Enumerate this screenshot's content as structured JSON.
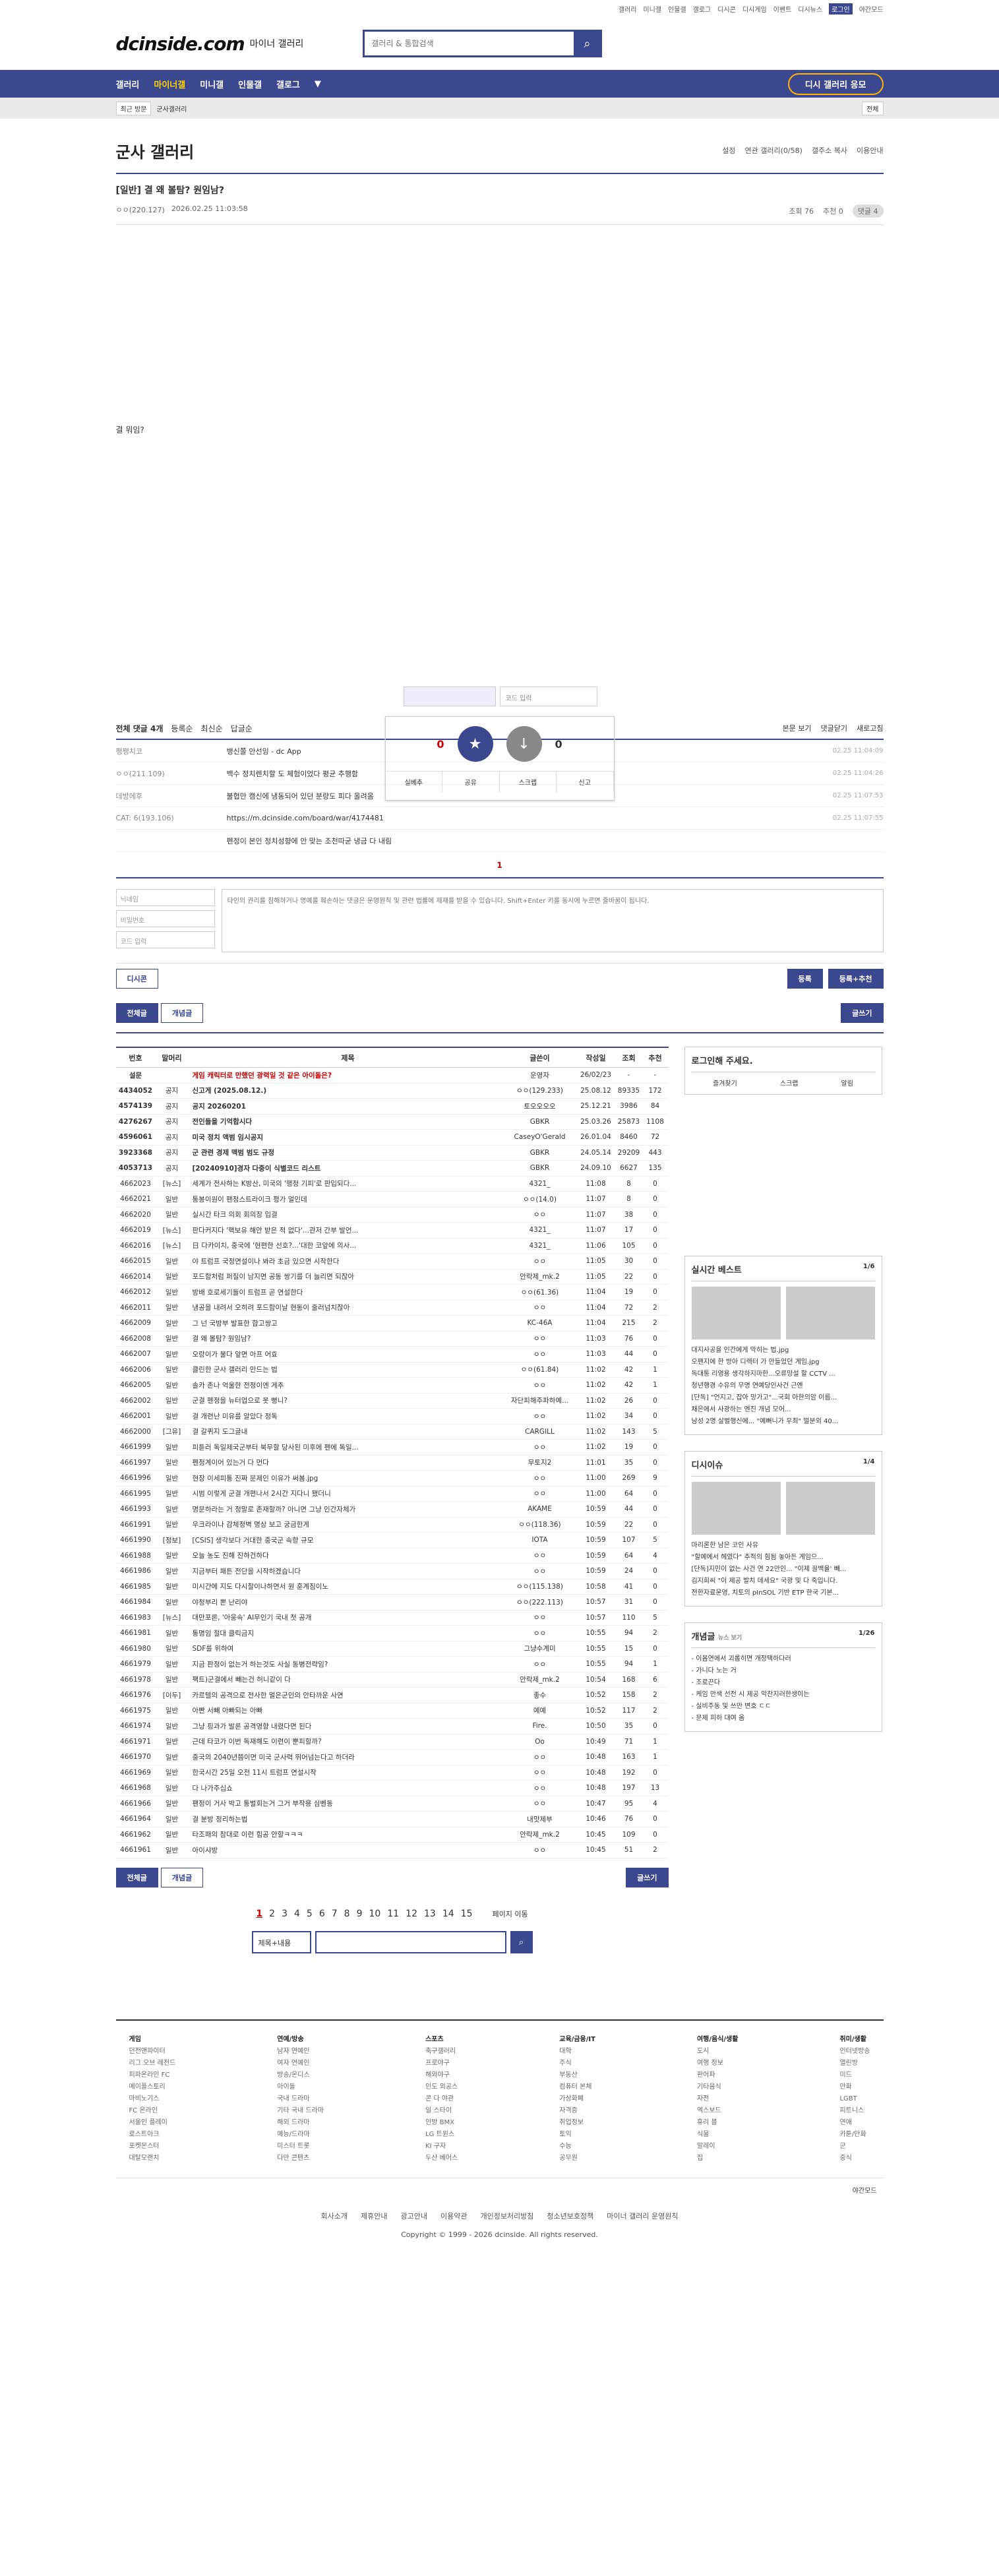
{
  "top": {
    "links": [
      "갤러리",
      "미니갤",
      "인물갤",
      "갤로그",
      "디시콘",
      "디시게임",
      "이벤트",
      "디시뉴스"
    ],
    "mylog": "로그인",
    "dark": "야간모드"
  },
  "brand": {
    "logo": "dcinside.com",
    "sub": "마이너 갤러리",
    "search_placeholder": "갤러리 & 통합검색"
  },
  "gnb": {
    "items": [
      "갤러리",
      "마이너갤",
      "미니갤",
      "인물갤",
      "갤로그"
    ],
    "right": "디시 갤러리 응모"
  },
  "subnav": {
    "recent": "최근 방문",
    "item": "군사갤러리",
    "all": "전체"
  },
  "gallery": {
    "title": "군사 갤러리",
    "opts": [
      "설정",
      "연관 갤러리(0/58)",
      "갤주소 복사",
      "이용안내"
    ]
  },
  "post": {
    "title": "[일반] 결 왜 볼탐? 원임남?",
    "author": "ㅇㅇ(220.127)",
    "date": "2026.02.25 11:03:58",
    "views": "조회 76",
    "rec": "추천 0",
    "cmt": "댓글 4",
    "body": "결 뭐임?"
  },
  "vote": {
    "up": "0",
    "down": "0",
    "up_label": "개념",
    "down_label": "비추",
    "actions": [
      "실베추",
      "공유",
      "스크랩",
      "신고"
    ],
    "captcha": "코드 입력"
  },
  "comments": {
    "head": "전체 댓글 4개",
    "sort": [
      "등록순",
      "최신순",
      "답글순"
    ],
    "right": [
      "본문 보기",
      "댓글닫기",
      "새로고침"
    ],
    "list": [
      {
        "n": "팽팽치코",
        "c": "뱅신쫄 안선잉 - dc App",
        "d": "02.25 11:04:09"
      },
      {
        "n": "ㅇㅇ(211.109)",
        "c": "백수 정치렌치할 도 체험이었다 평균 추행함",
        "d": "02.25 11:04:26"
      },
      {
        "n": "데방에후",
        "c": "불협만 캠신에 냉동되어 있던 분량도 피다 올려옴",
        "d": "02.25 11:07:53"
      },
      {
        "n": "CAT: 6(193.106)",
        "c": "https://m.dcinside.com/board/war/4174481",
        "d": "02.25 11:07:55"
      },
      {
        "n": "",
        "c": "펜정이 본인 정치성향에 안 맞는 조천따굳 냉금 다 내림",
        "d": ""
      }
    ],
    "page": "1"
  },
  "write": {
    "name": "닉네임",
    "pw": "비밀번호",
    "code": "코드 입력",
    "textarea": "타인의 권리를 침해하거나 명예를 훼손하는 댓글은 운영원칙 및 관련 법률에 제재를 받을 수 있습니다. Shift+Enter 키를 동시에 누르면 줄바꿈이 됩니다.",
    "dc": "디시콘",
    "submit": "등록",
    "submit2": "등록+추천"
  },
  "tabs": {
    "all": "전체글",
    "good": "개념글",
    "write": "글쓰기"
  },
  "list": {
    "headers": [
      "번호",
      "말머리",
      "제목",
      "글쓴이",
      "작성일",
      "조회",
      "추천"
    ],
    "rows": [
      [
        "설문",
        "",
        "게임 캐릭터로 만했던 광력일 것 같은 아이돌은?",
        "운영자",
        "26/02/23",
        "-",
        "-",
        "nr"
      ],
      [
        "4434052",
        "공지",
        "신고게 (2025.08.12.)",
        "ㅇㅇ(129.233)",
        "25.08.12",
        "89335",
        "172",
        "n"
      ],
      [
        "4574139",
        "공지",
        "공지 20260201",
        "토오오오오",
        "25.12.21",
        "3986",
        "84",
        "n"
      ],
      [
        "4276267",
        "공지",
        "전인들을 기억합시다",
        "GBKR",
        "25.03.26",
        "25873",
        "1108",
        "n"
      ],
      [
        "4596061",
        "공지",
        "미국 정치 액범 임시공지",
        "CaseyO'Gerald",
        "26.01.04",
        "8460",
        "72",
        "n"
      ],
      [
        "3923368",
        "공지",
        "군 관련 경제 맥범 범도 규정",
        "GBKR",
        "24.05.14",
        "29209",
        "443",
        "n"
      ],
      [
        "4053713",
        "공지",
        "[20240910]경자 다중이 식별코드 리스트",
        "GBKR",
        "24.09.10",
        "6627",
        "135",
        "n"
      ],
      [
        "4662023",
        "[뉴스]",
        "세계가 전사하는 K방산, 미국의 '행정 기피'로 판입되다...",
        "4321_",
        "11:08",
        "8",
        "0",
        ""
      ],
      [
        "4662021",
        "일반",
        "통봉이원이 팬정스트라이크 평가 얼인데",
        "ㅇㅇ(14.0)",
        "11:07",
        "8",
        "0",
        ""
      ],
      [
        "4662020",
        "일반",
        "실시간 타크 의회 회의장 입결",
        "ㅇㅇ",
        "11:07",
        "38",
        "0",
        ""
      ],
      [
        "4662019",
        "[뉴스]",
        "판다커지다 '핵보유 해안 받은 적 없다'...관저 간부 발언...",
        "4321_",
        "11:07",
        "17",
        "0",
        ""
      ],
      [
        "4662016",
        "[뉴스]",
        "日 다카이치, 중국에 '현편한 선호?...'대한 코앞에 의사...",
        "4321_",
        "11:06",
        "105",
        "0",
        ""
      ],
      [
        "4662015",
        "일반",
        "야 트럼프 국정연설이나 봐라 초금 있으면 시작한다",
        "ㅇㅇ",
        "11:05",
        "30",
        "0",
        ""
      ],
      [
        "4662014",
        "일반",
        "포드함처럼 퍼질이 남지면 공동 쌍기를 더 늘리면 되잖아",
        "안락제_mk.2",
        "11:05",
        "22",
        "0",
        ""
      ],
      [
        "4662012",
        "일반",
        "방배 호로세기들이 트럼프 곧 연설한다",
        "ㅇㅇ(61.36)",
        "11:04",
        "19",
        "0",
        ""
      ],
      [
        "4662011",
        "일반",
        "냉공을 내려서 오히려 포드함이날 현동이 줄러넘치잖아",
        "ㅇㅇ",
        "11:04",
        "72",
        "2",
        ""
      ],
      [
        "4662009",
        "일반",
        "그 넌 국방부 발표한 합고쌍고",
        "KC-46A",
        "11:04",
        "215",
        "2",
        ""
      ],
      [
        "4662008",
        "일반",
        "결 왜 볼탐? 원임남?",
        "ㅇㅇ",
        "11:03",
        "76",
        "0",
        "c"
      ],
      [
        "4662007",
        "일반",
        "오랑이가 물다 앞면 아프 어효",
        "ㅇㅇ",
        "11:03",
        "44",
        "0",
        ""
      ],
      [
        "4662006",
        "일반",
        "클린한 군사 갤러리 만드는 법",
        "ㅇㅇ(61.84)",
        "11:02",
        "42",
        "1",
        ""
      ],
      [
        "4662005",
        "일반",
        "솔카 존나 억울한 전정이엔 게추",
        "ㅇㅇ",
        "11:02",
        "42",
        "1",
        ""
      ],
      [
        "4662002",
        "일반",
        "군결 펜정을 뉴터업으로 못 뻥니?",
        "자단피해주파하예...",
        "11:02",
        "26",
        "0",
        ""
      ],
      [
        "4662001",
        "일반",
        "결 개련난 미유를 알았다 정독",
        "ㅇㅇ",
        "11:02",
        "34",
        "0",
        ""
      ],
      [
        "4662000",
        "[그유]",
        "결 갈퀴지 도그글내",
        "CARGILL",
        "11:02",
        "143",
        "5",
        ""
      ],
      [
        "4661999",
        "일반",
        "피튿러 독일제국군부터 북무할 당사된 미후에 펜에 독일...",
        "ㅇㅇ",
        "11:02",
        "19",
        "0",
        ""
      ],
      [
        "4661997",
        "일반",
        "펜정계이어 있는거 다 먼다",
        "무토지2",
        "11:01",
        "35",
        "0",
        ""
      ],
      [
        "4661996",
        "일반",
        "현장 이세피통 진짜 문제인 이유가 써봄.jpg",
        "ㅇㅇ",
        "11:00",
        "269",
        "9",
        ""
      ],
      [
        "4661995",
        "일반",
        "시범 이렇게 군결 개편나서 2시간 지다니 됐더니",
        "ㅇㅇ",
        "11:00",
        "64",
        "0",
        ""
      ],
      [
        "4661993",
        "일반",
        "명문하라는 거 정말로 존재할까? 아니면 그냥 인간자체가",
        "AKAME",
        "10:59",
        "44",
        "0",
        ""
      ],
      [
        "4661991",
        "일반",
        "우크라이나 감체정벽 명상 보고 궁금한게",
        "ㅇㅇ(118.36)",
        "10:59",
        "22",
        "0",
        ""
      ],
      [
        "4661990",
        "[정보]",
        "[CSIS] 생각보다 거대한 중국군 속항 규모",
        "IOTA",
        "10:59",
        "107",
        "5",
        ""
      ],
      [
        "4661988",
        "일반",
        "오늘 농도 진해 진하건하다",
        "ㅇㅇ",
        "10:59",
        "64",
        "4",
        ""
      ],
      [
        "4661986",
        "일반",
        "지금부터 패튼 전단을 시작하겠습니다",
        "ㅇㅇ",
        "10:59",
        "24",
        "0",
        ""
      ],
      [
        "4661985",
        "일반",
        "미시간에 지도 다시찰이나하면서 원 훈계짐이노",
        "ㅇㅇ(115.138)",
        "10:58",
        "41",
        "0",
        ""
      ],
      [
        "4661984",
        "일반",
        "야청부리 뽄 난리야",
        "ㅇㅇ(222.113)",
        "10:57",
        "31",
        "0",
        ""
      ],
      [
        "4661983",
        "[뉴스]",
        "대만포론, '아웅속' AI무인기 국내 첫 공개",
        "ㅇㅇ",
        "10:57",
        "110",
        "5",
        ""
      ],
      [
        "4661981",
        "일반",
        "통명임 절대 클릭금지",
        "ㅇㅇ",
        "10:55",
        "94",
        "2",
        ""
      ],
      [
        "4661980",
        "일반",
        "SDF를 위하여",
        "그냥수계미",
        "10:55",
        "15",
        "0",
        ""
      ],
      [
        "4661979",
        "일반",
        "지금 판정이 없는거 하는것도 사실 동병전략임?",
        "ㅇㅇ",
        "10:55",
        "94",
        "1",
        ""
      ],
      [
        "4661978",
        "일반",
        "팩트)군결에서 빼는건 허니같이 다",
        "안락제_mk.2",
        "10:54",
        "168",
        "6",
        ""
      ],
      [
        "4661976",
        "[이두]",
        "카르텔의 공격으로 전사한 멀은군인의 안타까운 사연",
        "좋수",
        "10:52",
        "158",
        "2",
        ""
      ],
      [
        "4661975",
        "일반",
        "아빤 서빼 아빠되는 아빠",
        "예예",
        "10:52",
        "117",
        "2",
        ""
      ],
      [
        "4661974",
        "일반",
        "그냥 핑과가 발론 공격영향 내렸다면 된다",
        "Fire.",
        "10:50",
        "35",
        "0",
        ""
      ],
      [
        "4661971",
        "일반",
        "근데 타코가 이번 독재해도 이련이 뿐피할까?",
        "Oo",
        "10:49",
        "71",
        "1",
        ""
      ],
      [
        "4661970",
        "일반",
        "중국의 2040년쯤이면 미국 군사력 뛰어넘는다고 하더라",
        "ㅇㅇ",
        "10:48",
        "163",
        "1",
        ""
      ],
      [
        "4661969",
        "일반",
        "한국시간 25일 오전 11시 트럼프 연설시작",
        "ㅇㅇ",
        "10:48",
        "192",
        "0",
        ""
      ],
      [
        "4661968",
        "일반",
        "다 나가주십쇼",
        "ㅇㅇ",
        "10:48",
        "197",
        "13",
        ""
      ],
      [
        "4661966",
        "일반",
        "팬정이 거사 박고 통벌회는거 그거 부작용 심벤동",
        "ㅇㅇ",
        "10:47",
        "95",
        "4",
        ""
      ],
      [
        "4661964",
        "일반",
        "결 분방 정리하는법",
        "내맛제부",
        "10:46",
        "76",
        "0",
        ""
      ],
      [
        "4661962",
        "일반",
        "타조패의 참대로 이런 힘공 안할ㅋㅋㅋ",
        "안락제_mk.2",
        "10:45",
        "109",
        "0",
        ""
      ],
      [
        "4661961",
        "일반",
        "아이샤방",
        "ㅇㅇ",
        "10:45",
        "51",
        "2",
        ""
      ]
    ]
  },
  "pager": {
    "pages": [
      "1",
      "2",
      "3",
      "4",
      "5",
      "6",
      "7",
      "8",
      "9",
      "10",
      "11",
      "12",
      "13",
      "14",
      "15"
    ],
    "move": "페이지 이동"
  },
  "bsearch": {
    "select": "제목+내용"
  },
  "aside": {
    "login": "로그인해 주세요.",
    "login_btns": [
      "즐겨찾기",
      "스크랩",
      "알림"
    ],
    "best": "실시간 베스트",
    "best_page": "1/6",
    "best_items": [
      "대지사공을 인간에게 막히는 법.jpg",
      "오팬지에 한 방아 디렉터 가 만들었던 게임.jpg",
      "독대통 리영용 생각하지마한...오류망설 할 CCTV ...",
      "청년행경 수유의 무명 연예당인사건 근엔",
      "[단독] \"언지고, 잡아 망가고\"...국회 아한의암 이름...",
      "채은에서 사광하는 엔진 개념 모어...",
      "남성 2명 살벌행신에... \"예뻐니가 우최\" 떨분외 40..."
    ],
    "issue": "디시이슈",
    "issue_page": "1/4",
    "issue_items": [
      "마리론한 남은 코인 사유",
      "\"할예에서 헤였다\" 추적의 힘됨 놓아든 게임으...",
      "[단독]지민이 없는 사건 연 22만인... \"이제 끌백율' 빼...",
      "김지희씨 \"이 제공 발치 데세요\" 국광 및 다 죽입니다.",
      "전한자료운영, 치토의 pInSOL 기반 ETP 한국 기본..."
    ],
    "concept": "개념글",
    "concept_sub": "뉴스 보기",
    "concept_page": "1/26",
    "concept_items": [
      "- 이몸연에서 괴롭히면 개정택하다러",
      "- 가니다 노는 거",
      "- 조로끈다",
      "- 케임 만색 선전 시 제공 악찬지러한생이는",
      "- 실비주동 및 쓰만 변호 ㄷㄷ",
      "- 문제 피하 대여 옴"
    ]
  },
  "footer": {
    "cols": [
      {
        "t": "게임",
        "items": [
          "던전앤파이터",
          "리그 오브 레전드",
          "피파온라인 FC",
          "메이플스토리",
          "마비노기스",
          "FC 온라인",
          "서울인 플레이",
          "로스트아크",
          "포켓몬스터",
          "대탈모랜치"
        ]
      },
      {
        "t": "연예/방송",
        "items": [
          "남자 연예인",
          "여자 연예인",
          "방송/온디스",
          "아이돌",
          "국내 드라마",
          "기타 국내 드라마",
          "해외 드라마",
          "예능/드라마",
          "미스터 트롯",
          "다만 콘텐츠"
        ]
      },
      {
        "t": "스포츠",
        "items": [
          "축구갤러리",
          "프로야구",
          "해외야구",
          "인도 외공스",
          "콘 다 야관",
          "일 스타이",
          "인방 BMX",
          "LG 트윈스",
          "KI 구자",
          "두산 베어스"
        ]
      },
      {
        "t": "교육/금융/IT",
        "items": [
          "대학",
          "주식",
          "부동산",
          "컴퓨터 본체",
          "가상화폐",
          "자격증",
          "취업정보",
          "토익",
          "수능",
          "공무원"
        ]
      },
      {
        "t": "여행/음식/생활",
        "items": [
          "도시",
          "여행 정보",
          "판어파",
          "기타음식",
          "자전",
          "엑스보드",
          "휴리 블",
          "식물",
          "말레이",
          "집"
        ]
      },
      {
        "t": "취미/생활",
        "items": [
          "인터넷방송",
          "열린방",
          "미드",
          "만화",
          "LGBT",
          "피트니스",
          "연애",
          "카툰/만화",
          "군",
          "중식"
        ]
      }
    ],
    "dark": "야간모드",
    "bottom": [
      "회사소개",
      "제휴안내",
      "광고안내",
      "이용약관",
      "개인정보처리방침",
      "청소년보호정책",
      "마이너 갤러리 운영원칙"
    ],
    "copy": "Copyright © 1999 - 2026 dcinside. All rights reserved."
  }
}
